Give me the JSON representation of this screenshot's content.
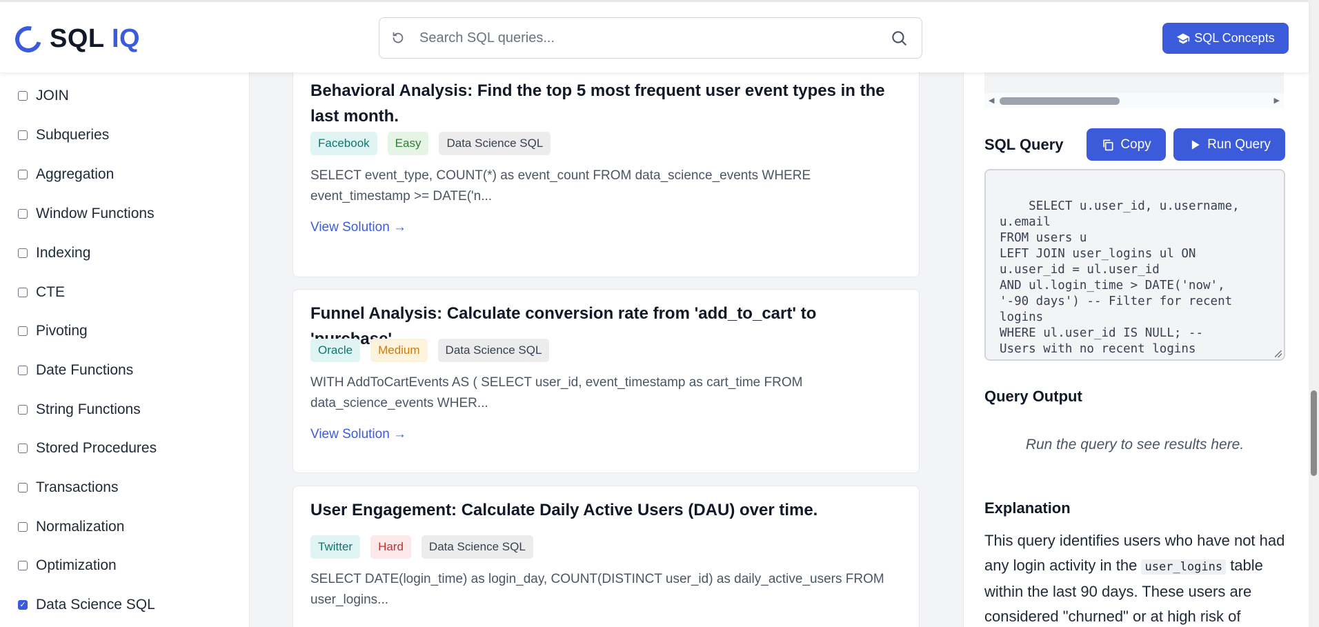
{
  "header": {
    "logo_main": "SQL",
    "logo_accent": "IQ",
    "search_placeholder": "Search SQL queries...",
    "concepts_button": "SQL Concepts",
    "accent_color": "#3b5bdb"
  },
  "sidebar": {
    "filters": [
      {
        "label": "JOIN",
        "checked": false
      },
      {
        "label": "Subqueries",
        "checked": false
      },
      {
        "label": "Aggregation",
        "checked": false
      },
      {
        "label": "Window Functions",
        "checked": false
      },
      {
        "label": "Indexing",
        "checked": false
      },
      {
        "label": "CTE",
        "checked": false
      },
      {
        "label": "Pivoting",
        "checked": false
      },
      {
        "label": "Date Functions",
        "checked": false
      },
      {
        "label": "String Functions",
        "checked": false
      },
      {
        "label": "Stored Procedures",
        "checked": false
      },
      {
        "label": "Transactions",
        "checked": false
      },
      {
        "label": "Normalization",
        "checked": false
      },
      {
        "label": "Optimization",
        "checked": false
      },
      {
        "label": "Data Science SQL",
        "checked": true
      }
    ]
  },
  "questions": [
    {
      "title": "Behavioral Analysis: Find the top 5 most frequent user event types in the last month.",
      "company": "Facebook",
      "difficulty": "Easy",
      "category": "Data Science SQL",
      "snippet": "SELECT event_type, COUNT(*) as event_count FROM data_science_events WHERE event_timestamp >= DATE('n...",
      "link": "View Solution →"
    },
    {
      "title": "Funnel Analysis: Calculate conversion rate from 'add_to_cart' to 'purchase'.",
      "company": "Oracle",
      "difficulty": "Medium",
      "category": "Data Science SQL",
      "snippet": "WITH AddToCartEvents AS ( SELECT user_id, event_timestamp as cart_time FROM data_science_events WHER...",
      "link": "View Solution →"
    },
    {
      "title": "User Engagement: Calculate Daily Active Users (DAU) over time.",
      "company": "Twitter",
      "difficulty": "Hard",
      "category": "Data Science SQL",
      "snippet": "SELECT DATE(login_time) as login_day, COUNT(DISTINCT user_id) as daily_active_users FROM user_logins...",
      "link": "View Solution →"
    }
  ],
  "panel": {
    "sql_label": "SQL Query",
    "copy_label": "Copy",
    "run_label": "Run Query",
    "code": "SELECT u.user_id, u.username,\nu.email\nFROM users u\nLEFT JOIN user_logins ul ON\nu.user_id = ul.user_id\nAND ul.login_time > DATE('now',\n'-90 days') -- Filter for recent\nlogins\nWHERE ul.user_id IS NULL; --\nUsers with no recent logins",
    "output_label": "Query Output",
    "output_message": "Run the query to see results here.",
    "explanation_label": "Explanation",
    "explanation_part1": "This query identifies users who have not had any login activity in the",
    "explanation_code": "user_logins",
    "explanation_part2": "table within the last 90 days. These users are considered \"churned\" or at high risk of"
  }
}
